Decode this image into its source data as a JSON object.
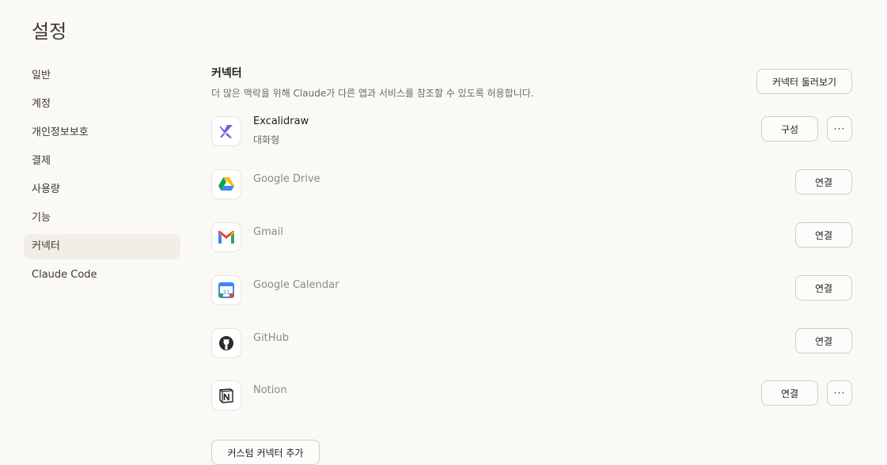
{
  "page": {
    "title": "설정"
  },
  "sidebar": {
    "items": [
      {
        "label": "일반"
      },
      {
        "label": "계정"
      },
      {
        "label": "개인정보보호"
      },
      {
        "label": "결제"
      },
      {
        "label": "사용량"
      },
      {
        "label": "기능"
      },
      {
        "label": "커넥터",
        "active": true
      },
      {
        "label": "Claude Code"
      }
    ]
  },
  "connectors": {
    "title": "커넥터",
    "description": "더 많은 맥락을 위해 Claude가 다른 앱과 서비스를 참조할 수 있도록 허용합니다.",
    "browse_label": "커넥터 둘러보기",
    "custom_add_label": "커스텀 커넥터 추가",
    "more_label": "···",
    "items": [
      {
        "name": "Excalidraw",
        "subtitle": "대화형",
        "icon": "excalidraw-icon",
        "action": "구성",
        "has_more": true
      },
      {
        "name": "Google Drive",
        "icon": "google-drive-icon",
        "action": "연결"
      },
      {
        "name": "Gmail",
        "icon": "gmail-icon",
        "action": "연결"
      },
      {
        "name": "Google Calendar",
        "icon": "google-calendar-icon",
        "action": "연결"
      },
      {
        "name": "GitHub",
        "icon": "github-icon",
        "action": "연결"
      },
      {
        "name": "Notion",
        "icon": "notion-icon",
        "action": "연결",
        "has_more": true
      }
    ]
  },
  "calendar_icon_text": "31",
  "colors": {
    "background": "#faf9f5",
    "active_sidebar": "#f0eee6",
    "excalidraw": "#6965db"
  }
}
